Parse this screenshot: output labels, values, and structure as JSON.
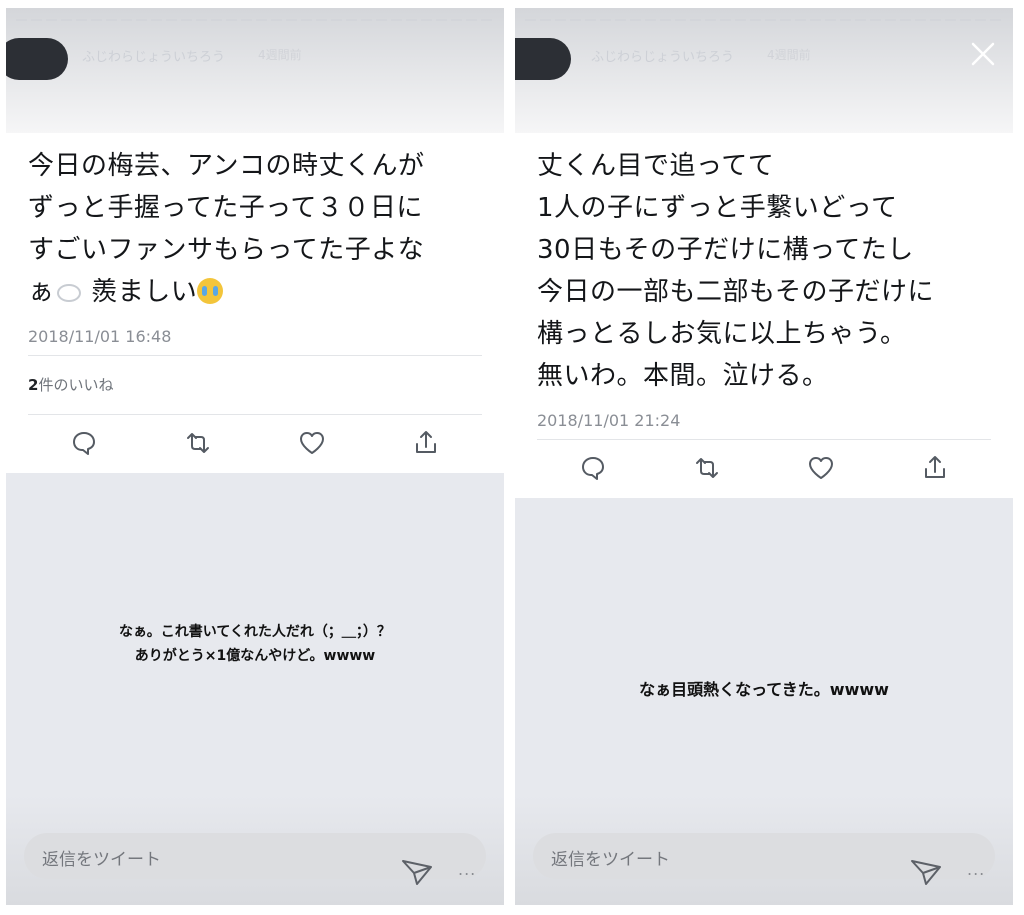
{
  "left": {
    "username": "ふじわらじょういちろう",
    "posted_ago": "4週間前",
    "tweet_lines": [
      "今日の梅芸、アンコの時丈くんが",
      "ずっと手握ってた子って３０日に",
      "すごいファンサもらってた子よな",
      "ぁ",
      "羨ましい"
    ],
    "timestamp": "2018/11/01 16:48",
    "likes_count": "2",
    "likes_label": "件のいいね",
    "caption_lines": [
      "なぁ。これ書いてくれた人だれ（；＿；）？",
      "ありがとう×1億なんやけど。wwww"
    ],
    "reply_placeholder": "返信をツイート",
    "more_label": "..."
  },
  "right": {
    "username": "ふじわらじょういちろう",
    "posted_ago": "4週間前",
    "tweet_lines": [
      "丈くん目で追ってて",
      "1人の子にずっと手繋いどって",
      "30日もその子だけに構ってたし",
      "今日の一部も二部もその子だけに",
      "構っとるしお気に以上ちゃう。",
      "無いわ。本間。泣ける。"
    ],
    "timestamp": "2018/11/01 21:24",
    "caption_lines": [
      "なぁ目頭熱くなってきた。wwww"
    ],
    "reply_placeholder": "返信をツイート",
    "more_label": "..."
  },
  "icons": [
    "close-icon",
    "reply-icon",
    "retweet-icon",
    "like-icon",
    "share-icon",
    "send-icon",
    "more-icon",
    "crying-face-emoji",
    "speech-bubble-emoji"
  ],
  "colors": {
    "redaction": "#2c2f35",
    "panel_bg": "#e7e9ee",
    "card_bg": "#ffffff",
    "meta_text": "#8a8e95"
  }
}
